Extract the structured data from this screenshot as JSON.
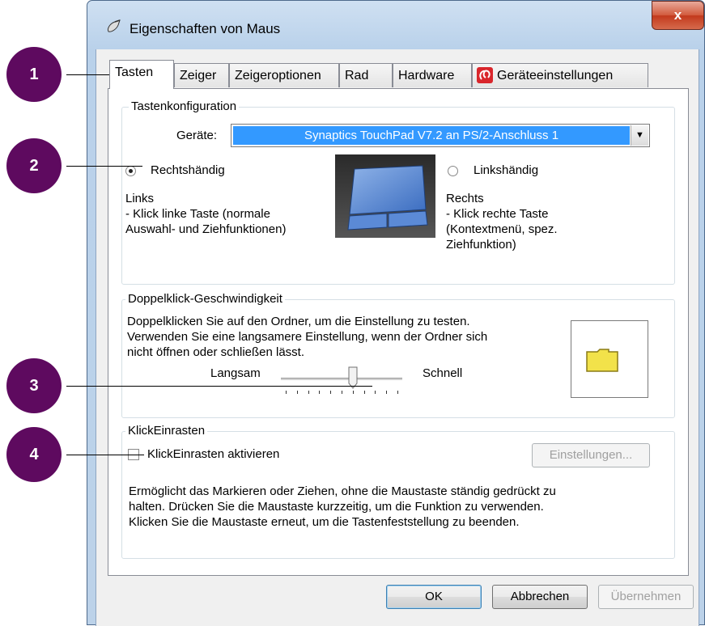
{
  "window": {
    "title": "Eigenschaften von Maus",
    "close_label": "x"
  },
  "tabs": [
    "Tasten",
    "Zeiger",
    "Zeigeroptionen",
    "Rad",
    "Hardware",
    "Geräteeinstellungen"
  ],
  "button_config": {
    "group_title": "Tastenkonfiguration",
    "device_label": "Geräte:",
    "device_value": "Synaptics TouchPad V7.2 an PS/2-Anschluss 1",
    "right_handed_label": "Rechtshändig",
    "left_handed_label": "Linkshändig",
    "left_title": "Links",
    "left_line1": " - Klick linke Taste (normale",
    "left_line2": "Auswahl- und Ziehfunktionen)",
    "right_title": "Rechts",
    "right_line1": " - Klick rechte Taste",
    "right_line2": "(Kontextmenü, spez.",
    "right_line3": "Ziehfunktion)"
  },
  "double_click": {
    "group_title": "Doppelklick-Geschwindigkeit",
    "line1": "Doppelklicken Sie auf den Ordner, um die Einstellung zu testen.",
    "line2": "Verwenden Sie eine langsamere Einstellung, wenn der Ordner sich",
    "line3": "nicht öffnen oder schließen lässt.",
    "slow_label": "Langsam",
    "fast_label": "Schnell",
    "slider_value": 0.6
  },
  "click_lock": {
    "group_title": "KlickEinrasten",
    "checkbox_label": "KlickEinrasten aktivieren",
    "settings_button": "Einstellungen...",
    "desc1": "Ermöglicht das Markieren oder Ziehen, ohne die Maustaste ständig gedrückt zu",
    "desc2": "halten. Drücken Sie die Maustaste kurzzeitig, um die Funktion zu verwenden.",
    "desc3": "Klicken Sie die Maustaste erneut, um die Tastenfeststellung zu beenden."
  },
  "buttons": {
    "ok": "OK",
    "cancel": "Abbrechen",
    "apply": "Übernehmen"
  },
  "callouts": [
    "1",
    "2",
    "3",
    "4"
  ],
  "colors": {
    "callout": "#5e0a5f",
    "selection": "#3399ff",
    "folder": "#f2e24a"
  }
}
